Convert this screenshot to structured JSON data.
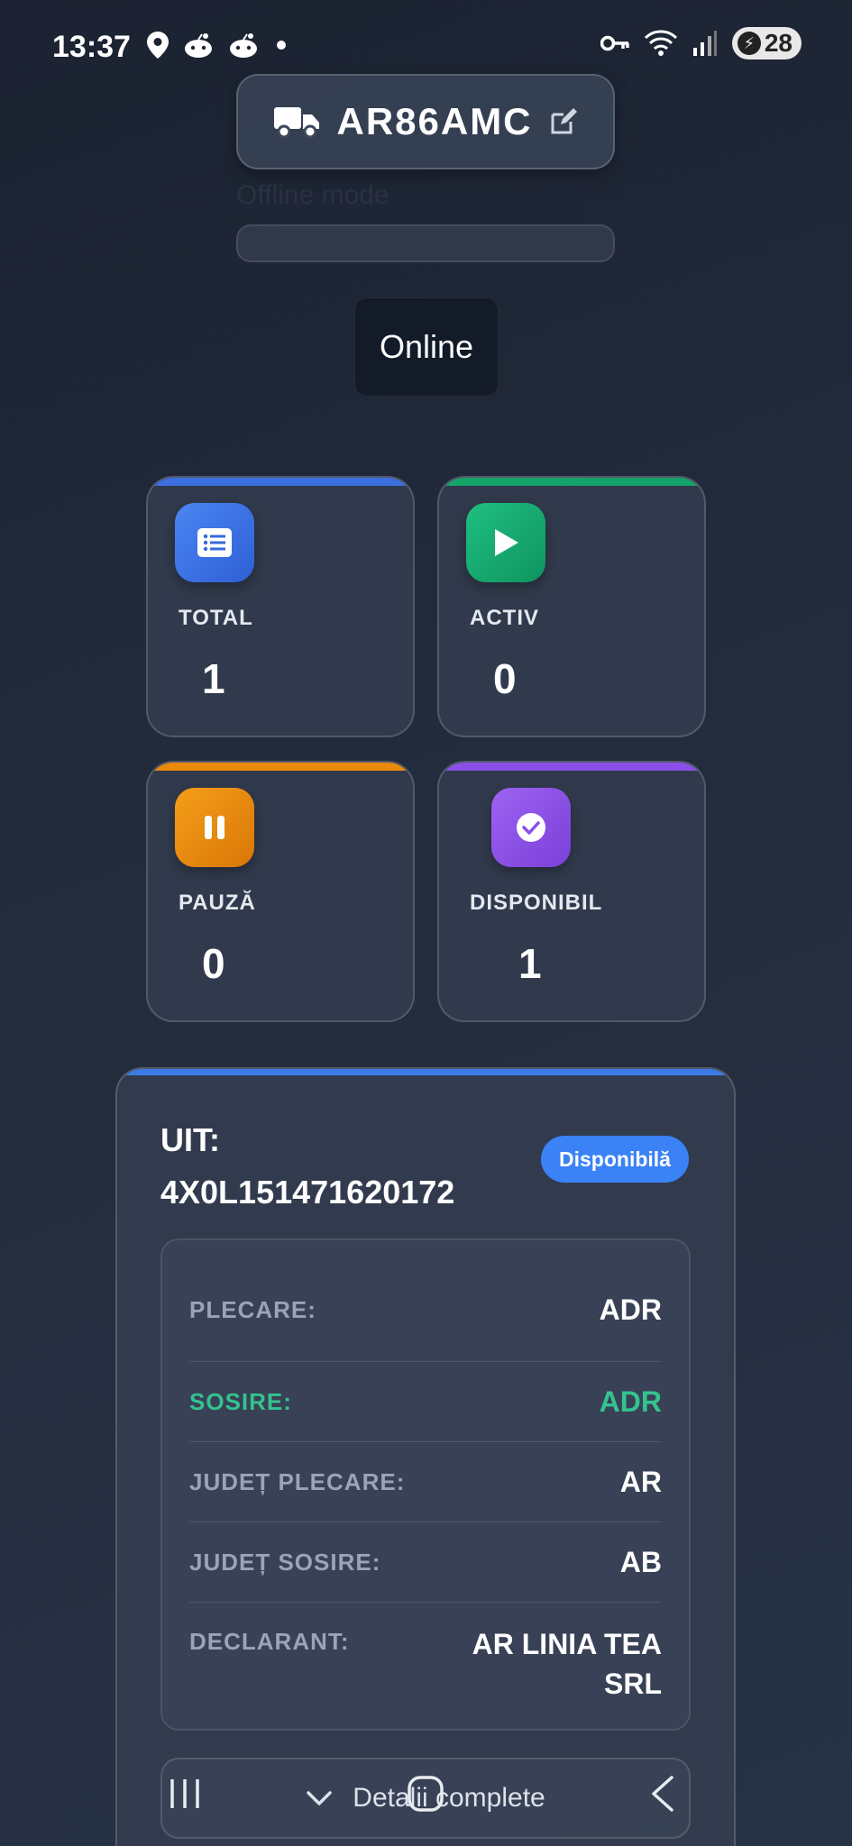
{
  "status_bar": {
    "time": "13:37",
    "left_icons": [
      "location-pin-icon",
      "reddit-icon",
      "reddit-icon",
      "dot-icon"
    ],
    "right_icons": [
      "key-icon",
      "wifi-icon",
      "signal-icon"
    ],
    "battery": "28"
  },
  "vehicle": {
    "plate": "AR86AMC",
    "faint_label": "Offline mode",
    "status_button": "Online"
  },
  "stats": [
    {
      "label": "TOTAL",
      "value": "1",
      "color": "#3b6fe0",
      "icon": "list-icon"
    },
    {
      "label": "ACTIV",
      "value": "0",
      "color": "#16a36a",
      "icon": "play-icon"
    },
    {
      "label": "PAUZĂ",
      "value": "0",
      "color": "#ea8a0c",
      "icon": "pause-icon"
    },
    {
      "label": "DISPONIBIL",
      "value": "1",
      "color": "#8b4fe8",
      "icon": "check-circle-icon"
    }
  ],
  "uit": {
    "title_line1": "UIT:",
    "title_line2": "4X0L151471620172",
    "badge": "Disponibilă",
    "rows": [
      {
        "key": "PLECARE:",
        "value": "ADR"
      },
      {
        "key": "SOSIRE:",
        "value": "ADR"
      },
      {
        "key": "JUDEȚ PLECARE:",
        "value": "AR"
      },
      {
        "key": "JUDEȚ SOSIRE:",
        "value": "AB"
      },
      {
        "key": "DECLARANT:",
        "value": "AR LINIA TEA SRL"
      }
    ],
    "details_button": "Detalii complete"
  },
  "colors": {
    "accent_blue": "#3b82f6",
    "sosire_green": "#34c38f"
  }
}
